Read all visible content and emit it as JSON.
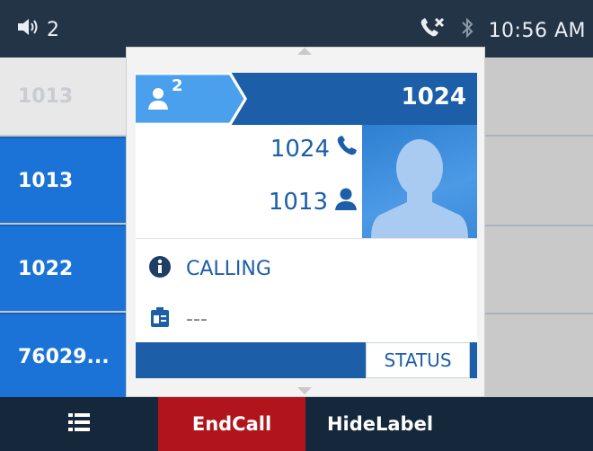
{
  "status_bar": {
    "volume_level": "2",
    "time": "10:56 AM",
    "icons": [
      "volume-icon",
      "missed-call-icon",
      "bluetooth-icon"
    ]
  },
  "lines": [
    {
      "label": "1013",
      "state": "active"
    },
    {
      "label": "1013",
      "state": "normal"
    },
    {
      "label": "1022",
      "state": "normal"
    },
    {
      "label": "76029...",
      "state": "normal"
    }
  ],
  "popup": {
    "conference_count": "2",
    "header_number": "1024",
    "remote_number": "1024",
    "local_number": "1013",
    "status_text": "CALLING",
    "extra_info": "---",
    "status_button": "STATUS"
  },
  "softkeys": {
    "menu_icon": "list-icon",
    "endcall_label": "EndCall",
    "hidelabel_label": "HideLabel"
  },
  "colors": {
    "accent_blue": "#1b73d8",
    "header_blue": "#1d5ea8",
    "endcall_red": "#b1141b"
  }
}
